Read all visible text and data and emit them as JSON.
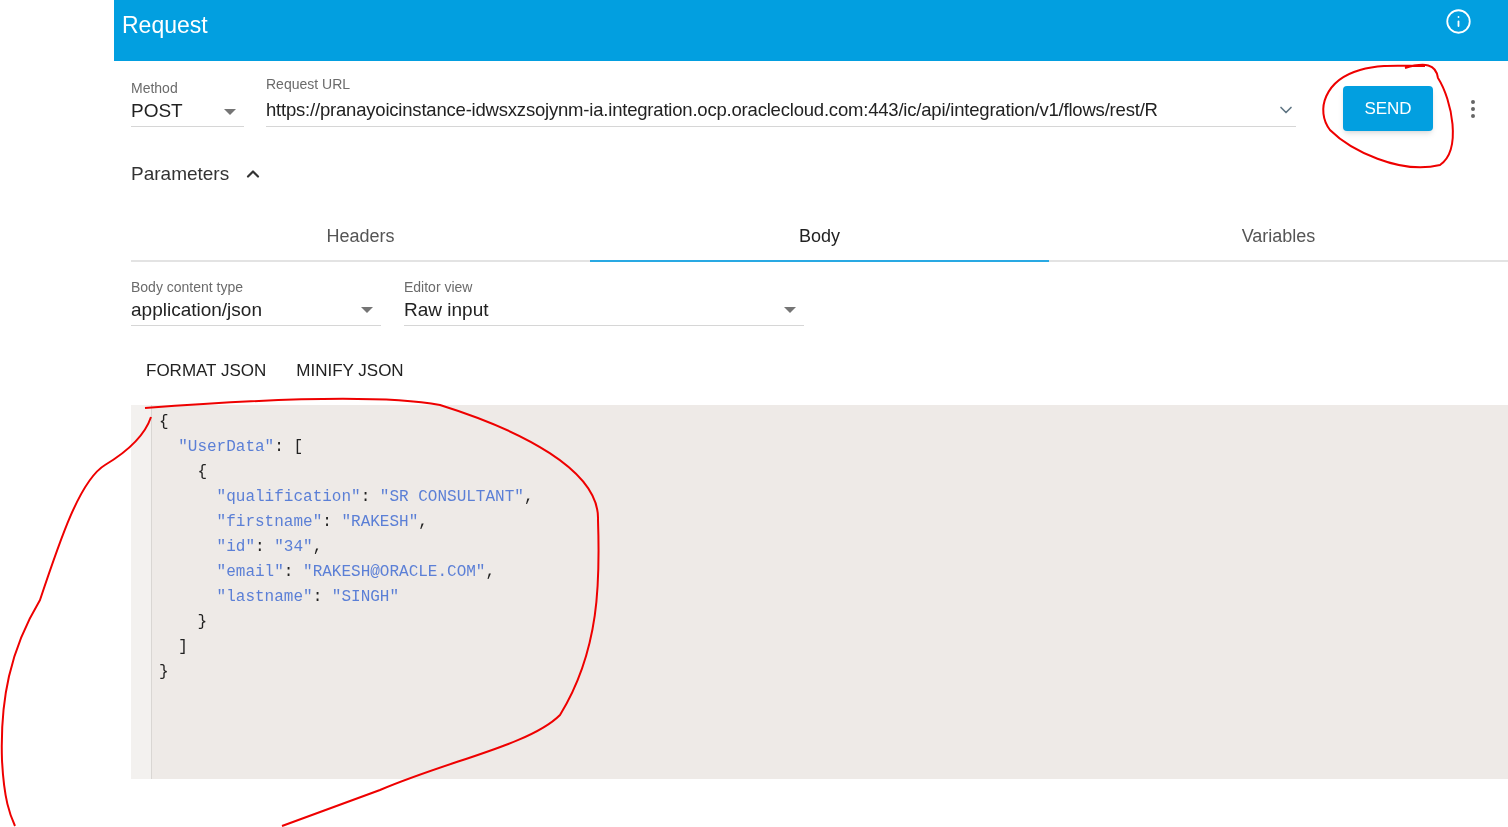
{
  "header": {
    "title": "Request"
  },
  "method": {
    "label": "Method",
    "value": "POST"
  },
  "url": {
    "label": "Request URL",
    "value": "https://pranayoicinstance-idwsxzsojynm-ia.integration.ocp.oraclecloud.com:443/ic/api/integration/v1/flows/rest/R"
  },
  "send_button": "SEND",
  "parameters": {
    "label": "Parameters",
    "expanded": true
  },
  "tabs": [
    {
      "label": "Headers",
      "selected": false
    },
    {
      "label": "Body",
      "selected": true
    },
    {
      "label": "Variables",
      "selected": false
    }
  ],
  "body_content_type": {
    "label": "Body content type",
    "value": "application/json"
  },
  "editor_view": {
    "label": "Editor view",
    "value": "Raw input"
  },
  "actions": [
    "FORMAT JSON",
    "MINIFY JSON"
  ],
  "code_lines": [
    [
      {
        "kind": "punct",
        "text": "{"
      }
    ],
    [
      {
        "kind": "key",
        "text": "  \"UserData\""
      },
      {
        "kind": "punct",
        "text": ": ["
      }
    ],
    [
      {
        "kind": "punct",
        "text": "    {"
      }
    ],
    [
      {
        "kind": "key",
        "text": "      \"qualification\""
      },
      {
        "kind": "punct",
        "text": ": "
      },
      {
        "kind": "string",
        "text": "\"SR CONSULTANT\""
      },
      {
        "kind": "punct",
        "text": ","
      }
    ],
    [
      {
        "kind": "key",
        "text": "      \"firstname\""
      },
      {
        "kind": "punct",
        "text": ": "
      },
      {
        "kind": "string",
        "text": "\"RAKESH\""
      },
      {
        "kind": "punct",
        "text": ","
      }
    ],
    [
      {
        "kind": "key",
        "text": "      \"id\""
      },
      {
        "kind": "punct",
        "text": ": "
      },
      {
        "kind": "string",
        "text": "\"34\""
      },
      {
        "kind": "punct",
        "text": ","
      }
    ],
    [
      {
        "kind": "key",
        "text": "      \"email\""
      },
      {
        "kind": "punct",
        "text": ": "
      },
      {
        "kind": "string",
        "text": "\"RAKESH@ORACLE.COM\""
      },
      {
        "kind": "punct",
        "text": ","
      }
    ],
    [
      {
        "kind": "key",
        "text": "      \"lastname\""
      },
      {
        "kind": "punct",
        "text": ": "
      },
      {
        "kind": "string",
        "text": "\"SINGH\""
      }
    ],
    [
      {
        "kind": "punct",
        "text": "    }"
      }
    ],
    [
      {
        "kind": "punct",
        "text": "  ]"
      }
    ],
    [
      {
        "kind": "punct",
        "text": "}"
      }
    ]
  ]
}
